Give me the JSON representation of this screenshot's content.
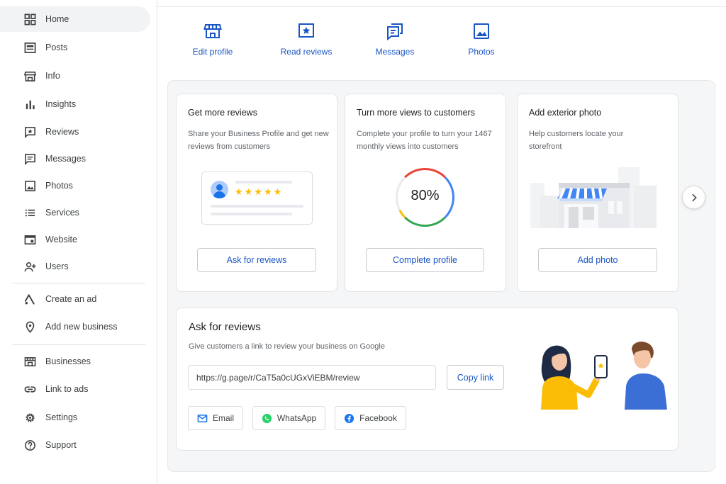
{
  "sidebar": {
    "items": [
      {
        "label": "Home",
        "icon": "dashboard-icon"
      },
      {
        "label": "Posts",
        "icon": "posts-icon"
      },
      {
        "label": "Info",
        "icon": "storefront-icon"
      },
      {
        "label": "Insights",
        "icon": "bar-chart-icon"
      },
      {
        "label": "Reviews",
        "icon": "reviews-icon"
      },
      {
        "label": "Messages",
        "icon": "message-icon"
      },
      {
        "label": "Photos",
        "icon": "photo-icon"
      },
      {
        "label": "Services",
        "icon": "list-icon"
      },
      {
        "label": "Website",
        "icon": "website-icon"
      },
      {
        "label": "Users",
        "icon": "add-user-icon"
      },
      {
        "label": "Create an ad",
        "icon": "ads-icon"
      },
      {
        "label": "Add new business",
        "icon": "location-pin-icon"
      },
      {
        "label": "Businesses",
        "icon": "businesses-icon"
      },
      {
        "label": "Link to ads",
        "icon": "link-icon"
      },
      {
        "label": "Settings",
        "icon": "gear-icon"
      },
      {
        "label": "Support",
        "icon": "help-icon"
      }
    ]
  },
  "top_actions": [
    {
      "label": "Edit profile",
      "icon": "storefront-icon"
    },
    {
      "label": "Read reviews",
      "icon": "star-box-icon"
    },
    {
      "label": "Messages",
      "icon": "messages-icon"
    },
    {
      "label": "Photos",
      "icon": "photo-icon"
    }
  ],
  "cards": {
    "reviews": {
      "title": "Get more reviews",
      "description": "Share your Business Profile and get new reviews from customers",
      "stars": "★★★★★",
      "button": "Ask for reviews"
    },
    "views": {
      "title": "Turn more views to customers",
      "description": "Complete your profile to turn your 1467 monthly views into customers",
      "progress_label": "80%",
      "progress_value": 0.8,
      "button": "Complete profile"
    },
    "photo": {
      "title": "Add exterior photo",
      "description": "Help customers locate your storefront",
      "button": "Add photo"
    }
  },
  "ask_reviews": {
    "title": "Ask for reviews",
    "description": "Give customers a link to review your business on Google",
    "link": "https://g.page/r/CaT5a0cUGxViEBM/review",
    "copy_button": "Copy link",
    "share": [
      {
        "label": "Email",
        "icon": "email-icon"
      },
      {
        "label": "WhatsApp",
        "icon": "whatsapp-icon"
      },
      {
        "label": "Facebook",
        "icon": "facebook-icon"
      }
    ]
  },
  "colors": {
    "accent": "#1a56c4",
    "google_blue": "#4285f4",
    "google_red": "#ea4335",
    "google_yellow": "#fbbc04",
    "google_green": "#34a853"
  }
}
